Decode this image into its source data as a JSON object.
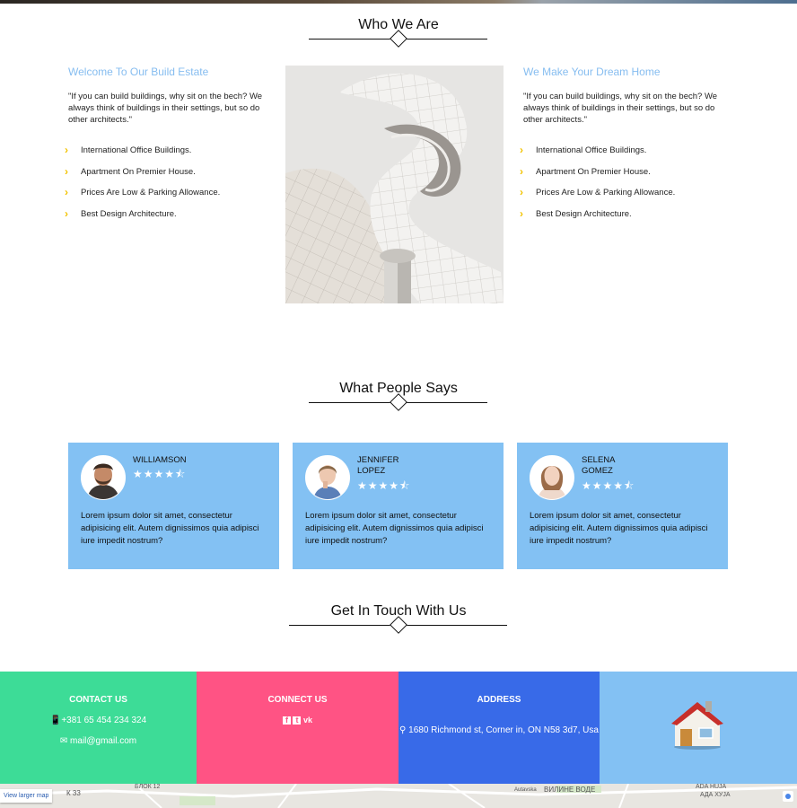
{
  "who_we_are": {
    "title": "Who We Are",
    "left": {
      "heading": "Welcome To Our Build Estate",
      "quote": "\"If you can build buildings, why sit on the bech? We always think of buildings in their settings, but so do other architects.\"",
      "items": [
        "International Office Buildings.",
        "Apartment On Premier House.",
        "Prices Are Low & Parking Allowance.",
        "Best Design Architecture."
      ]
    },
    "right": {
      "heading": "We Make Your Dream Home",
      "quote": "\"If you can build buildings, why sit on the bech? We always think of buildings in their settings, but so do other architects.\"",
      "items": [
        "International Office Buildings.",
        "Apartment On Premier House.",
        "Prices Are Low & Parking Allowance.",
        "Best Design Architecture."
      ]
    }
  },
  "testimonials": {
    "title": "What People Says",
    "cards": [
      {
        "name_line1": "WILLIAMSON",
        "name_line2": "",
        "stars": "★★★★⯪",
        "rating": 4.5,
        "text": "Lorem ipsum dolor sit amet, consectetur adipisicing elit. Autem dignissimos quia adipisci iure impedit nostrum?"
      },
      {
        "name_line1": "JENNIFER",
        "name_line2": "LOPEZ",
        "stars": "★★★★⯪",
        "rating": 4.5,
        "text": "Lorem ipsum dolor sit amet, consectetur adipisicing elit. Autem dignissimos quia adipisci iure impedit nostrum?"
      },
      {
        "name_line1": "SELENA",
        "name_line2": "GOMEZ",
        "stars": "★★★★⯪",
        "rating": 4.5,
        "text": "Lorem ipsum dolor sit amet, consectetur adipisicing elit. Autem dignissimos quia adipisci iure impedit nostrum?"
      }
    ]
  },
  "contact": {
    "title": "Get In Touch With Us",
    "contact_us": {
      "heading": "CONTACT US",
      "phone": "+381 65 454 234 324",
      "email": "mail@gmail.com"
    },
    "connect_us": {
      "heading": "CONNECT US",
      "icons": [
        "facebook-icon",
        "twitter-icon",
        "vk-icon"
      ]
    },
    "address": {
      "heading": "ADDRESS",
      "text": "1680 Richmond st, Corner in, ON N58 3d7, Usa"
    }
  },
  "map": {
    "link": "View larger map",
    "labels": [
      "К 33",
      "БЛОК 12",
      "Autavska",
      "ВИЛИНЕ ВОДЕ",
      "ADA HUJA",
      "АДА ХУЈА"
    ]
  },
  "colors": {
    "accent": "#83c1f3",
    "green": "#3ddc97",
    "pink": "#ff5384",
    "blue": "#386ae8",
    "star": "#f2c300"
  }
}
